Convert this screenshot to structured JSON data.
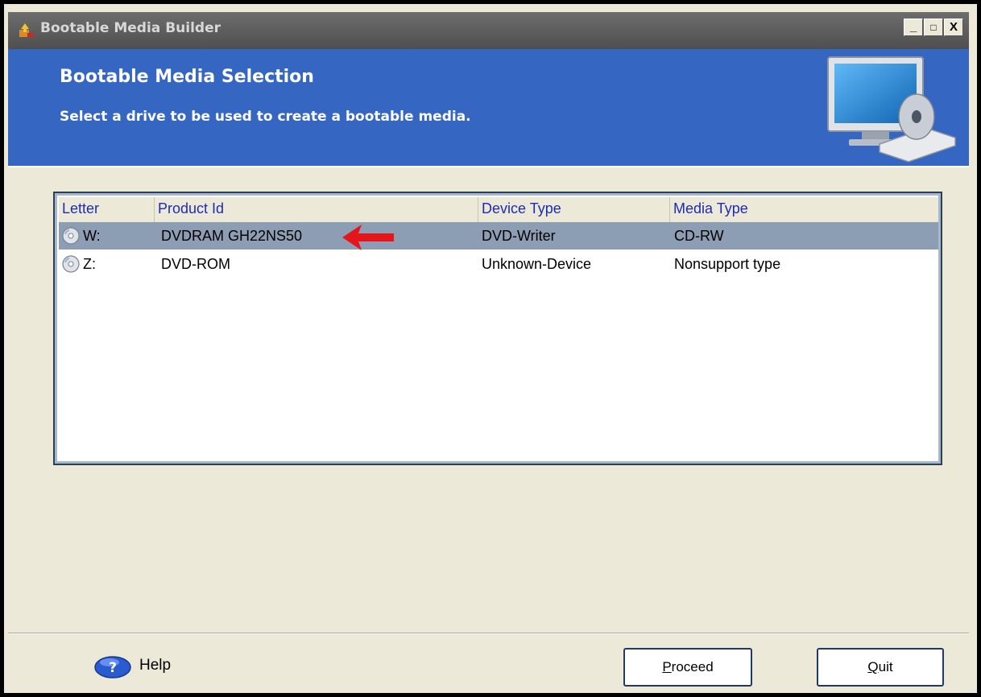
{
  "window": {
    "title": "Bootable Media Builder",
    "controls": {
      "minimize": "_",
      "maximize": "□",
      "close": "X"
    }
  },
  "header": {
    "title": "Bootable Media Selection",
    "subtitle": "Select a drive to be used to create a bootable media."
  },
  "list": {
    "columns": [
      "Letter",
      "Product Id",
      "Device Type",
      "Media Type"
    ],
    "rows": [
      {
        "letter": "W:",
        "product_id": "DVDRAM GH22NS50",
        "device_type": "DVD-Writer",
        "media_type": "CD-RW",
        "selected": true
      },
      {
        "letter": "Z:",
        "product_id": "DVD-ROM",
        "device_type": "Unknown-Device",
        "media_type": "Nonsupport type",
        "selected": false
      }
    ]
  },
  "footer": {
    "help_label": "Help",
    "proceed": {
      "mnemonic": "P",
      "rest": "roceed"
    },
    "quit": {
      "mnemonic": "Q",
      "rest": "uit"
    }
  },
  "colors": {
    "header_bg": "#3466c2",
    "selection": "#8d9db3",
    "arrow": "#e4161b",
    "title_bar": "#5c5c5c"
  },
  "icons": [
    "app-icon",
    "monitor-disc-icon",
    "disc-icon",
    "red-arrow-icon",
    "help-icon"
  ]
}
